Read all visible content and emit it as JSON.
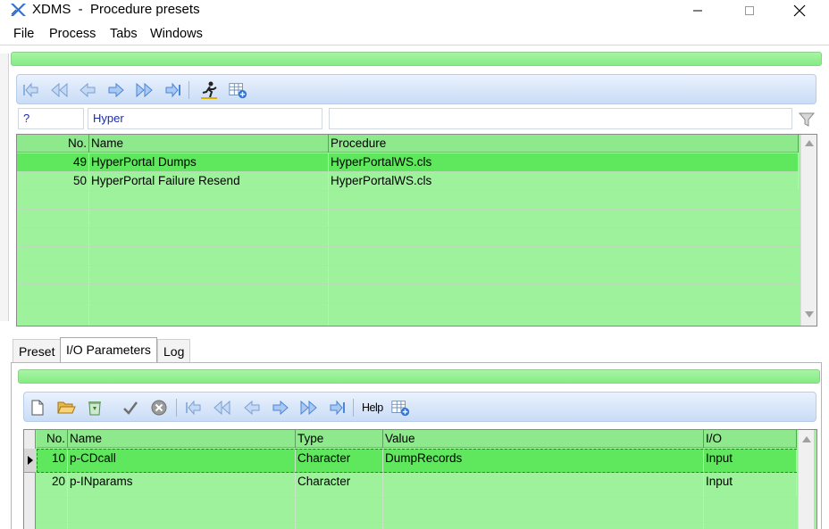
{
  "window": {
    "title": "XDMS  -  Procedure presets"
  },
  "menu": [
    "File",
    "Process",
    "Tabs",
    "Windows"
  ],
  "upper": {
    "filter_no": "?",
    "filter_name": "Hyper",
    "filter_procedure": "",
    "columns": [
      "No.",
      "Name",
      "Procedure"
    ],
    "rows": [
      {
        "no": "49",
        "name": "HyperPortal Dumps",
        "procedure": "HyperPortalWS.cls"
      },
      {
        "no": "50",
        "name": "HyperPortal Failure Resend",
        "procedure": "HyperPortalWS.cls"
      }
    ]
  },
  "tabs": [
    "Preset",
    "I/O Parameters",
    "Log"
  ],
  "active_tab": "I/O Parameters",
  "lower": {
    "help_label": "Help",
    "columns": [
      "No.",
      "Name",
      "Type",
      "Value",
      "I/O"
    ],
    "rows": [
      {
        "no": "10",
        "name": "p-CDcall",
        "type": "Character",
        "value": "DumpRecords",
        "io": "Input"
      },
      {
        "no": "20",
        "name": "p-INparams",
        "type": "Character",
        "value": "",
        "io": "Input"
      }
    ]
  },
  "colors": {
    "grid_green": "#9ef29c",
    "selected_green": "#5fe85d",
    "toolbar_blue": "#c9dcf6",
    "text_blue": "#1a2cb0"
  }
}
